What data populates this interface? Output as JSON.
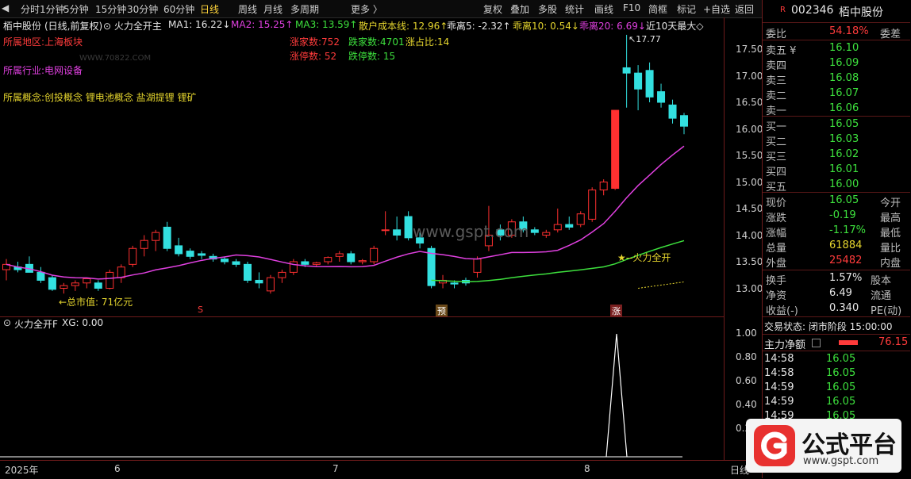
{
  "toolbar": {
    "periods": [
      "分时",
      "1分钟",
      "5分钟",
      "15分钟",
      "30分钟",
      "60分钟",
      "日线",
      "周线",
      "月线",
      "多周期",
      "更多 〉"
    ],
    "active_period": "日线",
    "tools": [
      "复权",
      "叠加",
      "多股",
      "统计",
      "画线",
      "F10",
      "简框",
      "标记",
      "+自选",
      "返回"
    ]
  },
  "chart_header": {
    "stock_name": "栢中股份",
    "adj_mode": "(日线,前复权)",
    "indicator": "火力全开主",
    "ma1": "MA1: 16.22↓",
    "ma2": "MA2: 15.25↑",
    "ma3": "MA3: 13.59↑",
    "cost_line": "散户成本线: 12.96↑",
    "guai5": "乖离5: -2.32↑",
    "guai10": "乖离10: 0.54↓",
    "guai20": "乖离20: 6.69↓",
    "max10": "近10天最大◇"
  },
  "info": {
    "region": "所属地区:上海板块",
    "industry": "所属行业:电网设备",
    "concept": "所属概念:创投概念 锂电池概念 盐湖提锂 锂矿",
    "watermark": "WWW.70822.COM",
    "up_count": "涨家数:752",
    "down_count": "跌家数:4701",
    "up_ratio": "涨占比:14",
    "limit_up": "涨停数: 52",
    "limit_down": "跌停数: 15"
  },
  "annotations": {
    "max_price": "17.77",
    "market_cap": "←总市值: 71亿元",
    "fire_label": "★--火力全开",
    "site": "www.gspt.com",
    "marker_s": "S",
    "marker_yu": "预",
    "marker_zhang": "涨"
  },
  "sub_header": {
    "indicator": "火力全开F",
    "xg": "XG: 0.00"
  },
  "axes": {
    "main_y": [
      "17.50",
      "17.00",
      "16.50",
      "16.00",
      "15.50",
      "15.00",
      "14.50",
      "14.00",
      "13.50",
      "13.00"
    ],
    "sub_y": [
      "1.00",
      "0.80",
      "0.60",
      "0.40",
      "0.20"
    ],
    "x_labels": [
      "2025年",
      "6",
      "7",
      "8"
    ],
    "x_right": "日线"
  },
  "panel": {
    "code": "002346",
    "name": "栢中股份",
    "weibi_label": "委比",
    "weibi_value": "54.18%",
    "weicha_label": "委差",
    "asks": [
      {
        "label": "卖五 ¥",
        "price": "16.10"
      },
      {
        "label": "卖四",
        "price": "16.09"
      },
      {
        "label": "卖三",
        "price": "16.08"
      },
      {
        "label": "卖二",
        "price": "16.07"
      },
      {
        "label": "卖一",
        "price": "16.06"
      }
    ],
    "bids": [
      {
        "label": "买一",
        "price": "16.05"
      },
      {
        "label": "买二",
        "price": "16.03"
      },
      {
        "label": "买三",
        "price": "16.02"
      },
      {
        "label": "买四",
        "price": "16.01"
      },
      {
        "label": "买五",
        "price": "16.00"
      }
    ],
    "stats": [
      {
        "l": "现价",
        "v": "16.05",
        "r": "今开",
        "vc": "green"
      },
      {
        "l": "涨跌",
        "v": "-0.19",
        "r": "最高",
        "vc": "green"
      },
      {
        "l": "涨幅",
        "v": "-1.17%",
        "r": "最低",
        "vc": "green"
      },
      {
        "l": "总量",
        "v": "61884",
        "r": "量比",
        "vc": "yellow"
      },
      {
        "l": "外盘",
        "v": "25482",
        "r": "内盘",
        "vc": "red"
      }
    ],
    "stats2": [
      {
        "l": "换手",
        "v": "1.57%",
        "r": "股本"
      },
      {
        "l": "净资",
        "v": "6.49",
        "r": "流通"
      },
      {
        "l": "收益(-)",
        "v": "0.340",
        "r": "PE(动)"
      }
    ],
    "trade_status": "交易状态: 闭市阶段 15:00:00",
    "main_net_label": "主力净额",
    "main_net_value": "76.15",
    "ticks": [
      {
        "t": "14:58",
        "p": "16.05"
      },
      {
        "t": "14:58",
        "p": "16.05"
      },
      {
        "t": "14:59",
        "p": "16.05"
      },
      {
        "t": "14:59",
        "p": "16.05"
      },
      {
        "t": "14:59",
        "p": "16.05"
      }
    ]
  },
  "logo": {
    "title": "公式平台",
    "url": "www.gspt.com"
  },
  "colors": {
    "up": "#ff3030",
    "down": "#33e0e0",
    "ma1": "#e6e6e6",
    "ma2": "#e040e0",
    "ma3": "#3de03d"
  },
  "chart_data": {
    "type": "candlestick",
    "ylim": [
      12.7,
      17.9
    ],
    "candles": [
      {
        "o": 13.35,
        "h": 13.55,
        "l": 13.15,
        "c": 13.45
      },
      {
        "o": 13.4,
        "h": 13.5,
        "l": 13.3,
        "c": 13.35
      },
      {
        "o": 13.45,
        "h": 13.6,
        "l": 13.3,
        "c": 13.3
      },
      {
        "o": 13.3,
        "h": 13.4,
        "l": 13.1,
        "c": 13.15
      },
      {
        "o": 13.2,
        "h": 13.25,
        "l": 12.95,
        "c": 12.98
      },
      {
        "o": 13.0,
        "h": 13.1,
        "l": 12.9,
        "c": 13.05
      },
      {
        "o": 13.05,
        "h": 13.15,
        "l": 12.95,
        "c": 13.1
      },
      {
        "o": 13.1,
        "h": 13.2,
        "l": 13.0,
        "c": 13.18
      },
      {
        "o": 13.1,
        "h": 13.15,
        "l": 12.95,
        "c": 13.0
      },
      {
        "o": 13.0,
        "h": 13.35,
        "l": 12.98,
        "c": 13.3
      },
      {
        "o": 13.2,
        "h": 13.45,
        "l": 13.1,
        "c": 13.4
      },
      {
        "o": 13.45,
        "h": 13.8,
        "l": 13.4,
        "c": 13.75
      },
      {
        "o": 13.75,
        "h": 14.0,
        "l": 13.6,
        "c": 13.9
      },
      {
        "o": 13.9,
        "h": 14.1,
        "l": 13.7,
        "c": 14.05
      },
      {
        "o": 14.15,
        "h": 14.25,
        "l": 13.7,
        "c": 13.75
      },
      {
        "o": 13.8,
        "h": 13.95,
        "l": 13.6,
        "c": 13.65
      },
      {
        "o": 13.7,
        "h": 13.75,
        "l": 13.55,
        "c": 13.6
      },
      {
        "o": 13.65,
        "h": 13.7,
        "l": 13.55,
        "c": 13.62
      },
      {
        "o": 13.6,
        "h": 13.65,
        "l": 13.5,
        "c": 13.55
      },
      {
        "o": 13.55,
        "h": 13.6,
        "l": 13.45,
        "c": 13.5
      },
      {
        "o": 13.5,
        "h": 13.55,
        "l": 13.4,
        "c": 13.45
      },
      {
        "o": 13.45,
        "h": 13.5,
        "l": 13.1,
        "c": 13.15
      },
      {
        "o": 13.15,
        "h": 13.3,
        "l": 13.0,
        "c": 13.1
      },
      {
        "o": 12.95,
        "h": 13.25,
        "l": 12.9,
        "c": 13.2
      },
      {
        "o": 13.2,
        "h": 13.35,
        "l": 13.1,
        "c": 13.3
      },
      {
        "o": 13.3,
        "h": 13.55,
        "l": 13.25,
        "c": 13.5
      },
      {
        "o": 13.5,
        "h": 13.55,
        "l": 13.4,
        "c": 13.45
      },
      {
        "o": 13.45,
        "h": 13.5,
        "l": 13.4,
        "c": 13.48
      },
      {
        "o": 13.5,
        "h": 13.6,
        "l": 13.45,
        "c": 13.58
      },
      {
        "o": 13.6,
        "h": 13.7,
        "l": 13.5,
        "c": 13.65
      },
      {
        "o": 13.65,
        "h": 13.7,
        "l": 13.45,
        "c": 13.5
      },
      {
        "o": 13.5,
        "h": 13.55,
        "l": 13.45,
        "c": 13.52
      },
      {
        "o": 13.5,
        "h": 13.8,
        "l": 13.45,
        "c": 13.75
      },
      {
        "o": 14.1,
        "h": 14.45,
        "l": 14.0,
        "c": 14.1
      },
      {
        "o": 14.1,
        "h": 14.35,
        "l": 13.9,
        "c": 14.0
      },
      {
        "o": 14.35,
        "h": 14.45,
        "l": 13.9,
        "c": 13.95
      },
      {
        "o": 13.95,
        "h": 14.05,
        "l": 13.75,
        "c": 13.85
      },
      {
        "o": 13.75,
        "h": 13.8,
        "l": 13.0,
        "c": 13.05
      },
      {
        "o": 13.1,
        "h": 13.25,
        "l": 13.0,
        "c": 13.15
      },
      {
        "o": 13.1,
        "h": 13.15,
        "l": 13.0,
        "c": 13.08
      },
      {
        "o": 13.15,
        "h": 13.2,
        "l": 13.05,
        "c": 13.1
      },
      {
        "o": 13.3,
        "h": 13.6,
        "l": 13.2,
        "c": 13.55
      },
      {
        "o": 13.8,
        "h": 14.55,
        "l": 13.7,
        "c": 14.0
      },
      {
        "o": 14.1,
        "h": 14.2,
        "l": 13.9,
        "c": 14.0
      },
      {
        "o": 14.0,
        "h": 14.3,
        "l": 13.95,
        "c": 14.25
      },
      {
        "o": 14.25,
        "h": 14.35,
        "l": 14.05,
        "c": 14.1
      },
      {
        "o": 14.1,
        "h": 14.15,
        "l": 14.0,
        "c": 14.05
      },
      {
        "o": 14.0,
        "h": 14.1,
        "l": 13.95,
        "c": 14.05
      },
      {
        "o": 14.1,
        "h": 14.5,
        "l": 14.05,
        "c": 14.2
      },
      {
        "o": 14.2,
        "h": 14.35,
        "l": 14.1,
        "c": 14.15
      },
      {
        "o": 14.2,
        "h": 14.45,
        "l": 14.15,
        "c": 14.4
      },
      {
        "o": 14.3,
        "h": 14.9,
        "l": 14.25,
        "c": 14.85
      },
      {
        "o": 14.85,
        "h": 15.05,
        "l": 14.75,
        "c": 15.0
      },
      {
        "o": 14.88,
        "h": 16.35,
        "l": 14.85,
        "c": 16.35
      },
      {
        "o": 17.15,
        "h": 17.77,
        "l": 16.4,
        "c": 17.05
      },
      {
        "o": 17.05,
        "h": 17.2,
        "l": 16.35,
        "c": 16.75
      },
      {
        "o": 17.1,
        "h": 17.25,
        "l": 16.5,
        "c": 16.6
      },
      {
        "o": 16.7,
        "h": 16.85,
        "l": 16.4,
        "c": 16.5
      },
      {
        "o": 16.45,
        "h": 16.55,
        "l": 16.1,
        "c": 16.2
      },
      {
        "o": 16.25,
        "h": 16.3,
        "l": 15.9,
        "c": 16.05
      }
    ],
    "ma_rising_slow": "green",
    "signal_peak": 1.0
  }
}
